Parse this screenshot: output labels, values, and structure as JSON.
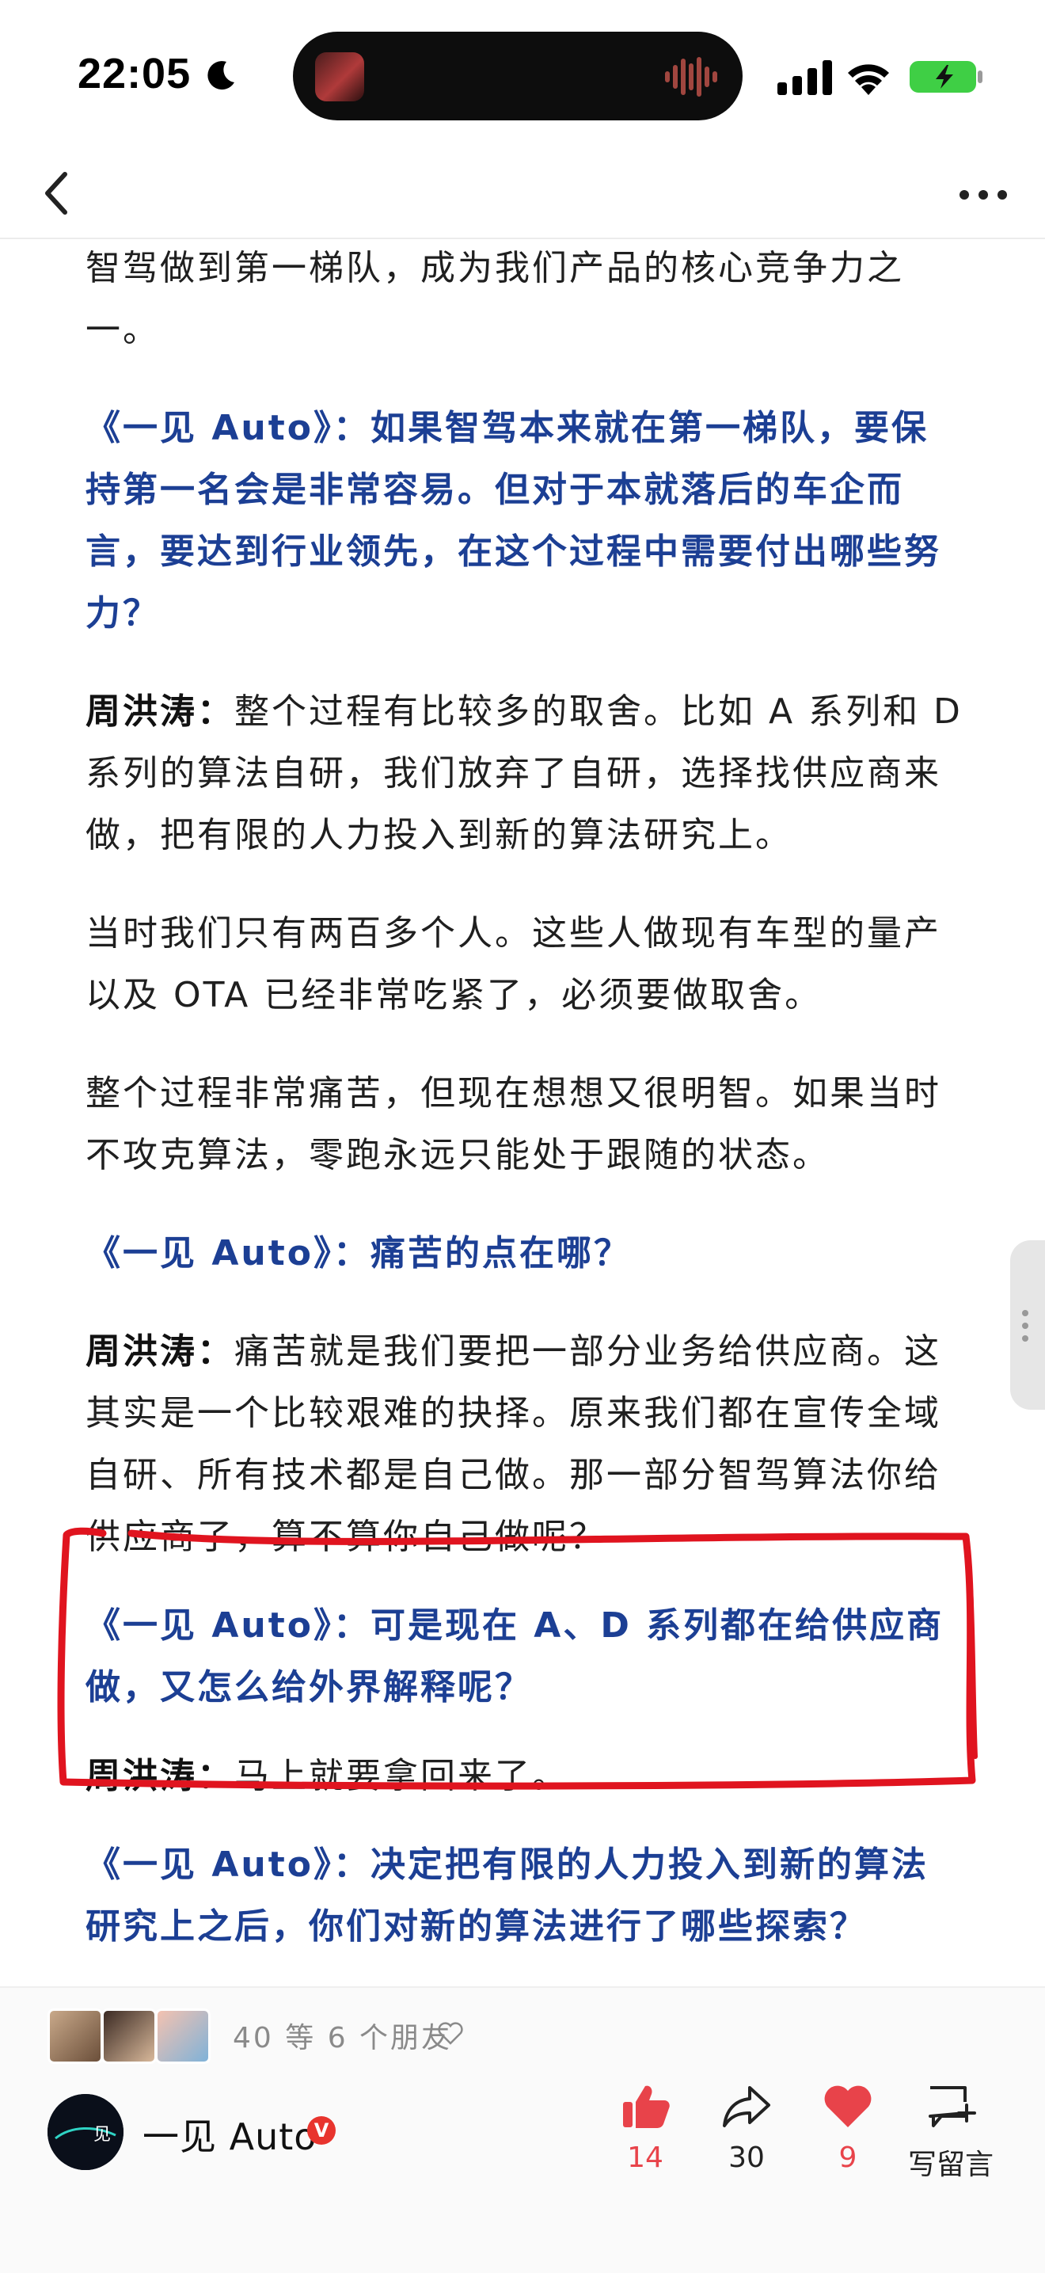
{
  "status_bar": {
    "time": "22:05",
    "icons": [
      "moon-icon",
      "signal-icon",
      "wifi-icon",
      "battery-charging-icon"
    ]
  },
  "nav": {
    "icons": [
      "back-arrow-icon",
      "more-dots-icon"
    ]
  },
  "article": {
    "p1_line1": "智驾做到第一梯队，成为我们产品的核心竞争力之",
    "p1_line2": "一。",
    "q1": "《一见 Auto》：如果智驾本来就在第一梯队，要保持第一名会是非常容易。但对于本就落后的车企而言，要达到行业领先，在这个过程中需要付出哪些努力？",
    "a1_speaker": "周洪涛：",
    "a1_text": "整个过程有比较多的取舍。比如 A 系列和 D 系列的算法自研，我们放弃了自研，选择找供应商来做，把有限的人力投入到新的算法研究上。",
    "p2": "当时我们只有两百多个人。这些人做现有车型的量产以及 OTA 已经非常吃紧了，必须要做取舍。",
    "p3": "整个过程非常痛苦，但现在想想又很明智。如果当时不攻克算法，零跑永远只能处于跟随的状态。",
    "q2": "《一见 Auto》：痛苦的点在哪？",
    "a2_speaker": "周洪涛：",
    "a2_text": "痛苦就是我们要把一部分业务给供应商。这其实是一个比较艰难的抉择。原来我们都在宣传全域自研、所有技术都是自己做。那一部分智驾算法你给供应商了，算不算你自己做呢？",
    "q3": "《一见 Auto》：可是现在 A、D 系列都在给供应商做，又怎么给外界解释呢？",
    "a3_speaker": "周洪涛：",
    "a3_text": "马上就要拿回来了。",
    "q4": "《一见 Auto》：决定把有限的人力投入到新的算法研究上之后，你们对新的算法进行了哪些探索？"
  },
  "annotation": {
    "color": "#e0141f"
  },
  "footer": {
    "friends_text": "40 等 6 个朋友",
    "account_name": "一见 Auto",
    "verified_badge": "V",
    "like_count": "14",
    "share_count": "30",
    "heart_count": "9",
    "comment_label": "写留言"
  },
  "colors": {
    "question_blue": "#1c3f94",
    "accent_red": "#e8434a"
  }
}
